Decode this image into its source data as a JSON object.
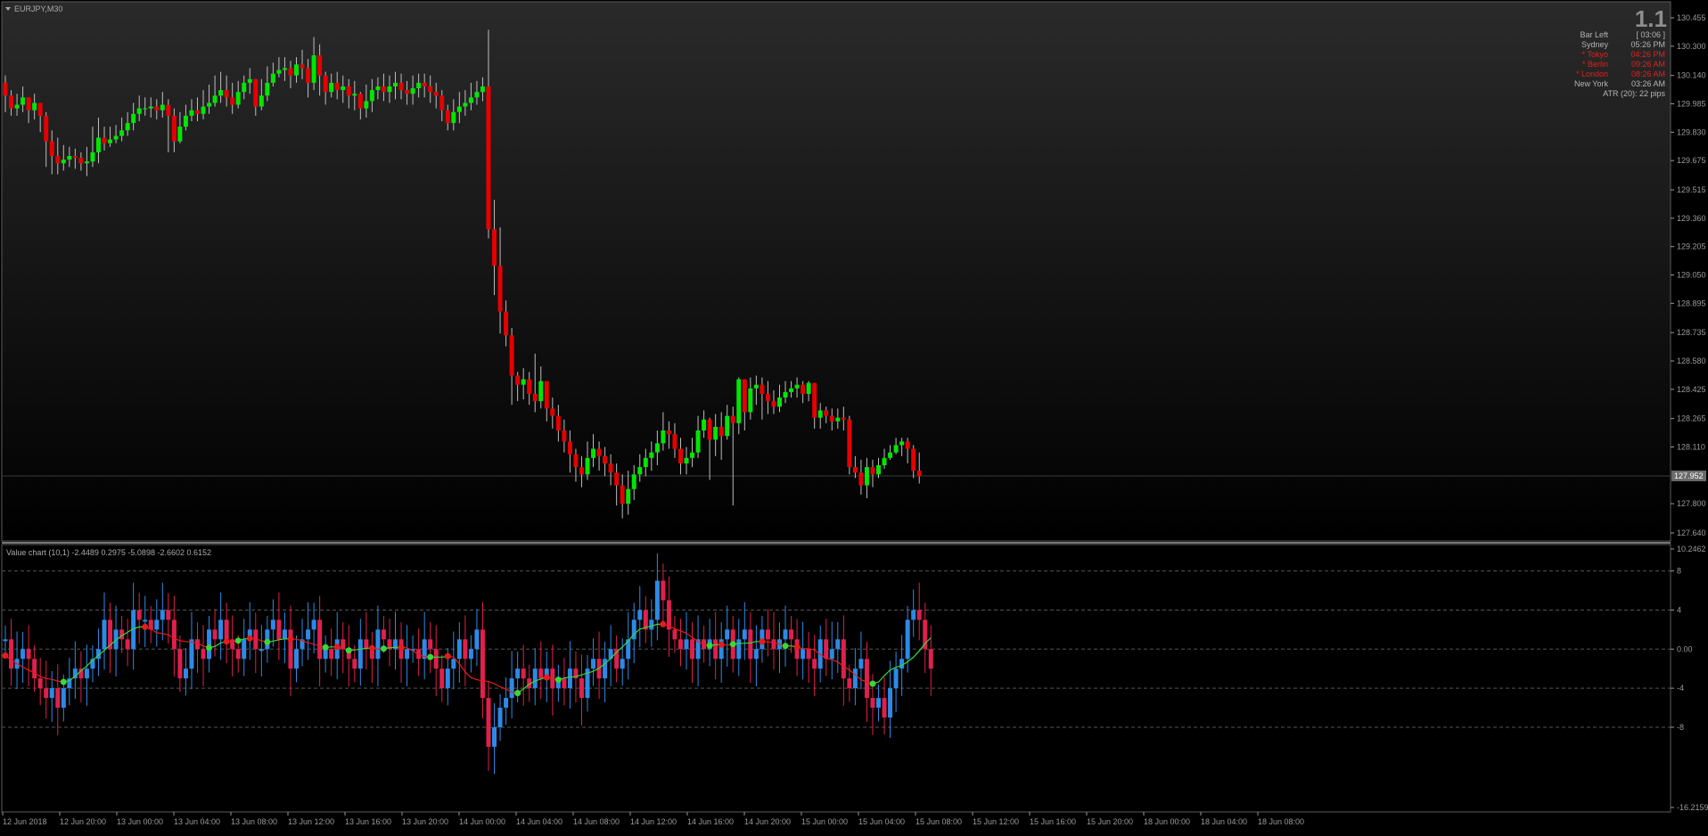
{
  "window": {
    "symbol_label": "EURJPY,M30"
  },
  "info_panel": {
    "big_value": "1.1",
    "rows": [
      {
        "label": "Bar Left",
        "value": "[ 03:06 ]",
        "color": "#b4b4b4"
      },
      {
        "label": "Sydney",
        "value": "05:26 PM",
        "color": "#b4b4b4"
      },
      {
        "label": "* Tokyo",
        "value": "04:26 PM",
        "color": "#e02020"
      },
      {
        "label": "* Berlin",
        "value": "09:26 AM",
        "color": "#e02020"
      },
      {
        "label": "* London",
        "value": "08:26 AM",
        "color": "#e02020"
      },
      {
        "label": "New York",
        "value": "03:26 AM",
        "color": "#b4b4b4"
      }
    ],
    "atr_text": "ATR (20): 22 pips"
  },
  "indicator": {
    "label": "Value chart (10,1) -2.4489 0.2975 -5.0898 -2.6602 0.6152"
  },
  "colors": {
    "bull": "#00e600",
    "bear": "#e60000",
    "value_up": "#2c8ae6",
    "value_down": "#e0204c",
    "line_up": "#39d839",
    "line_down": "#e61c1c",
    "axis": "#9a9a9a"
  },
  "chart_data": [
    {
      "type": "candlestick",
      "title": "EURJPY,M30",
      "ylim": [
        127.64,
        130.455
      ],
      "y_ticks": [
        "130.455",
        "130.300",
        "130.140",
        "129.985",
        "129.830",
        "129.675",
        "129.515",
        "129.360",
        "129.205",
        "129.050",
        "128.895",
        "128.735",
        "128.580",
        "128.425",
        "128.265",
        "128.110",
        "127.952",
        "127.800",
        "127.640"
      ],
      "current_price": "127.952",
      "x_tick_labels": [
        "12 Jun 2018",
        "12 Jun 20:00",
        "13 Jun 00:00",
        "13 Jun 04:00",
        "13 Jun 08:00",
        "13 Jun 12:00",
        "13 Jun 16:00",
        "13 Jun 20:00",
        "14 Jun 00:00",
        "14 Jun 04:00",
        "14 Jun 08:00",
        "14 Jun 12:00",
        "14 Jun 16:00",
        "14 Jun 20:00",
        "15 Jun 00:00",
        "15 Jun 04:00",
        "15 Jun 08:00",
        "15 Jun 12:00",
        "15 Jun 16:00",
        "15 Jun 20:00",
        "18 Jun 00:00",
        "18 Jun 04:00",
        "18 Jun 08:00"
      ],
      "close": [
        130.03,
        129.96,
        129.98,
        130.02,
        129.95,
        129.99,
        129.92,
        129.78,
        129.7,
        129.66,
        129.68,
        129.7,
        129.69,
        129.66,
        129.67,
        129.72,
        129.8,
        129.77,
        129.79,
        129.81,
        129.84,
        129.88,
        129.93,
        129.96,
        129.96,
        129.97,
        129.95,
        129.98,
        129.92,
        129.78,
        129.86,
        129.92,
        129.95,
        129.93,
        129.97,
        129.99,
        130.03,
        130.06,
        130.02,
        129.98,
        130.05,
        130.1,
        130.12,
        129.97,
        130.03,
        130.1,
        130.15,
        130.17,
        130.18,
        130.14,
        130.2,
        130.18,
        130.1,
        130.25,
        130.14,
        130.05,
        130.1,
        130.06,
        130.08,
        130.03,
        130.04,
        129.96,
        130.0,
        130.06,
        130.08,
        130.05,
        130.08,
        130.1,
        130.06,
        130.04,
        130.07,
        130.1,
        130.08,
        130.05,
        130.03,
        129.95,
        129.88,
        129.94,
        129.97,
        129.99,
        130.02,
        130.05,
        130.08,
        129.3,
        129.1,
        128.85,
        128.72,
        128.5,
        128.45,
        128.48,
        128.4,
        128.36,
        128.47,
        128.32,
        128.28,
        128.2,
        128.14,
        128.07,
        128.0,
        127.96,
        128.05,
        128.1,
        128.06,
        128.02,
        127.97,
        127.9,
        127.8,
        127.88,
        127.96,
        128.0,
        128.05,
        128.08,
        128.13,
        128.2,
        128.18,
        128.1,
        128.02,
        128.05,
        128.08,
        128.2,
        128.26,
        128.15,
        128.22,
        128.17,
        128.28,
        128.24,
        128.48,
        128.3,
        128.43,
        128.45,
        128.4,
        128.36,
        128.33,
        128.38,
        128.41,
        128.43,
        128.45,
        128.4,
        128.46,
        128.27,
        128.31,
        128.28,
        128.25,
        128.27,
        128.26,
        128.0,
        127.97,
        127.9,
        128.0,
        127.96,
        128.01,
        128.05,
        128.08,
        128.12,
        128.14,
        128.1,
        127.98,
        127.95
      ],
      "high": [
        130.14,
        130.06,
        130.04,
        130.08,
        130.02,
        130.04,
        129.99,
        129.94,
        129.84,
        129.8,
        129.76,
        129.75,
        129.74,
        129.72,
        129.75,
        129.86,
        129.91,
        129.86,
        129.86,
        129.87,
        129.91,
        129.94,
        129.99,
        130.03,
        130.02,
        130.02,
        130.01,
        130.05,
        130.01,
        129.96,
        129.94,
        129.98,
        130.01,
        130.02,
        130.06,
        130.09,
        130.14,
        130.16,
        130.14,
        130.1,
        130.11,
        130.14,
        130.18,
        130.12,
        130.12,
        130.19,
        130.21,
        130.24,
        130.24,
        130.22,
        130.24,
        130.28,
        130.23,
        130.35,
        130.31,
        130.16,
        130.15,
        130.16,
        130.14,
        130.12,
        130.11,
        130.05,
        130.09,
        130.12,
        130.13,
        130.15,
        130.14,
        130.16,
        130.15,
        130.11,
        130.14,
        130.15,
        130.15,
        130.14,
        130.1,
        130.06,
        129.98,
        130.01,
        130.05,
        130.06,
        130.1,
        130.11,
        130.13,
        130.39,
        129.46,
        129.31,
        128.91,
        128.76,
        128.52,
        128.54,
        128.52,
        128.62,
        128.55,
        128.46,
        128.38,
        128.34,
        128.26,
        128.2,
        128.1,
        128.06,
        128.14,
        128.18,
        128.14,
        128.11,
        128.07,
        128.02,
        127.96,
        127.98,
        128.01,
        128.07,
        128.1,
        128.14,
        128.2,
        128.3,
        128.25,
        128.24,
        128.16,
        128.11,
        128.16,
        128.28,
        128.31,
        128.27,
        128.29,
        128.3,
        128.34,
        128.33,
        128.49,
        128.48,
        128.49,
        128.5,
        128.49,
        128.47,
        128.42,
        128.45,
        128.47,
        128.47,
        128.49,
        128.47,
        128.47,
        128.44,
        128.35,
        128.33,
        128.32,
        128.32,
        128.33,
        128.28,
        128.06,
        128.04,
        128.05,
        128.04,
        128.05,
        128.1,
        128.12,
        128.16,
        128.16,
        128.16,
        128.12,
        128.08
      ],
      "low": [
        129.94,
        129.92,
        129.92,
        129.94,
        129.88,
        129.9,
        129.83,
        129.64,
        129.6,
        129.6,
        129.62,
        129.64,
        129.63,
        129.62,
        129.59,
        129.64,
        129.66,
        129.73,
        129.75,
        129.77,
        129.78,
        129.81,
        129.84,
        129.89,
        129.92,
        129.91,
        129.9,
        129.91,
        129.72,
        129.72,
        129.77,
        129.84,
        129.89,
        129.89,
        129.9,
        129.93,
        129.97,
        129.99,
        129.97,
        129.93,
        129.96,
        130.01,
        130.04,
        129.92,
        129.95,
        130.0,
        130.08,
        130.13,
        130.11,
        130.07,
        130.1,
        130.12,
        130.02,
        130.06,
        130.03,
        129.98,
        130.02,
        130.01,
        129.99,
        129.96,
        129.95,
        129.9,
        129.91,
        129.94,
        130.01,
        130.0,
        129.99,
        130.01,
        130.01,
        129.98,
        129.98,
        130.02,
        130.02,
        129.99,
        129.96,
        129.89,
        129.84,
        129.84,
        129.88,
        129.92,
        129.95,
        129.98,
        130.0,
        129.25,
        128.94,
        128.73,
        128.66,
        128.34,
        128.36,
        128.37,
        128.34,
        128.3,
        128.32,
        128.25,
        128.21,
        128.14,
        128.08,
        127.97,
        127.92,
        127.89,
        127.93,
        128.0,
        127.98,
        127.95,
        127.9,
        127.79,
        127.72,
        127.74,
        127.82,
        127.92,
        127.95,
        127.98,
        128.01,
        128.09,
        128.1,
        128.05,
        127.96,
        127.96,
        128.0,
        128.05,
        128.16,
        127.93,
        128.06,
        128.04,
        128.15,
        127.79,
        128.18,
        128.2,
        128.26,
        128.34,
        128.26,
        128.29,
        128.29,
        128.3,
        128.35,
        128.38,
        128.38,
        128.35,
        128.36,
        128.21,
        128.21,
        128.24,
        128.2,
        128.21,
        128.2,
        127.96,
        127.94,
        127.85,
        127.83,
        127.89,
        127.94,
        127.99,
        128.04,
        128.07,
        128.06,
        128.02,
        127.94,
        127.91
      ],
      "open": [
        130.1,
        130.03,
        129.96,
        129.98,
        130.02,
        129.95,
        129.99,
        129.92,
        129.78,
        129.7,
        129.66,
        129.68,
        129.7,
        129.69,
        129.66,
        129.67,
        129.72,
        129.8,
        129.77,
        129.79,
        129.81,
        129.84,
        129.88,
        129.93,
        129.96,
        129.96,
        129.97,
        129.95,
        129.98,
        129.92,
        129.78,
        129.86,
        129.92,
        129.95,
        129.93,
        129.97,
        129.99,
        130.03,
        130.06,
        130.02,
        129.98,
        130.05,
        130.1,
        130.12,
        129.97,
        130.03,
        130.1,
        130.15,
        130.17,
        130.18,
        130.14,
        130.2,
        130.18,
        130.1,
        130.25,
        130.14,
        130.05,
        130.1,
        130.06,
        130.08,
        130.03,
        130.04,
        129.96,
        130.0,
        130.06,
        130.08,
        130.05,
        130.08,
        130.1,
        130.06,
        130.04,
        130.07,
        130.1,
        130.08,
        130.05,
        130.03,
        129.95,
        129.88,
        129.94,
        129.97,
        129.99,
        130.02,
        130.05,
        130.08,
        129.3,
        129.1,
        128.85,
        128.72,
        128.5,
        128.45,
        128.48,
        128.4,
        128.36,
        128.47,
        128.32,
        128.28,
        128.2,
        128.14,
        128.07,
        128.0,
        127.96,
        128.05,
        128.1,
        128.06,
        128.02,
        127.97,
        127.9,
        127.8,
        127.88,
        127.96,
        128.0,
        128.05,
        128.08,
        128.13,
        128.2,
        128.18,
        128.1,
        128.02,
        128.05,
        128.08,
        128.2,
        128.26,
        128.15,
        128.22,
        128.17,
        128.28,
        128.24,
        128.48,
        128.3,
        128.43,
        128.45,
        128.4,
        128.36,
        128.33,
        128.38,
        128.41,
        128.43,
        128.45,
        128.4,
        128.46,
        128.27,
        128.31,
        128.28,
        128.25,
        128.27,
        128.26,
        128.0,
        127.97,
        127.9,
        128.0,
        127.96,
        128.01,
        128.05,
        128.08,
        128.12,
        128.14,
        128.1,
        127.98
      ]
    },
    {
      "type": "candlestick",
      "title": "Value chart (10,1) -2.4489 0.2975 -5.0898 -2.6602 0.6152",
      "ylim": [
        -16.2159,
        10.2462
      ],
      "y_ticks": [
        "10.2462",
        "8",
        "4",
        "0.00",
        "-4",
        "-8",
        "-16.2159"
      ],
      "levels": [
        8,
        4,
        0,
        -4,
        -8
      ],
      "open": [
        1,
        1,
        -2,
        -1,
        0,
        -1,
        -3,
        -4,
        -5,
        -4,
        -6,
        -4,
        -3,
        -2,
        -3,
        -2,
        -1,
        0,
        3,
        0,
        2,
        1,
        0,
        4,
        3,
        3,
        2,
        3,
        4,
        3,
        0,
        -3,
        -2,
        1,
        0,
        -1,
        2,
        1,
        3,
        1,
        0,
        -1,
        1,
        2,
        0,
        0,
        2,
        3,
        1,
        2,
        -2,
        0,
        1,
        2,
        3,
        -1,
        0,
        -1,
        1,
        0,
        -1,
        -2,
        1,
        0,
        -1,
        2,
        1,
        0,
        1,
        -1,
        0,
        0,
        -1,
        1,
        0,
        -2,
        -4,
        -2,
        -1,
        1,
        -1,
        0,
        2,
        -5,
        -10,
        -8,
        -6,
        -5,
        -3,
        -2,
        -3,
        -4,
        -2,
        -3,
        -2,
        -4,
        -3,
        -4,
        -2,
        -3,
        -5,
        -2,
        -1,
        -3,
        -1,
        0,
        -2,
        -1,
        1,
        3,
        4,
        2,
        3,
        7,
        5,
        2,
        1,
        0,
        1,
        -1,
        1,
        0,
        1,
        -1,
        1,
        2,
        -1,
        1,
        2,
        -1,
        0,
        2,
        1,
        0,
        1,
        2,
        1,
        -1,
        0,
        -1,
        -2,
        1,
        -1,
        0,
        1,
        -3,
        -4,
        -2,
        -1,
        -5,
        -6,
        -5,
        -7,
        -4,
        -2,
        -1,
        3,
        4,
        3,
        0
      ]
    }
  ]
}
